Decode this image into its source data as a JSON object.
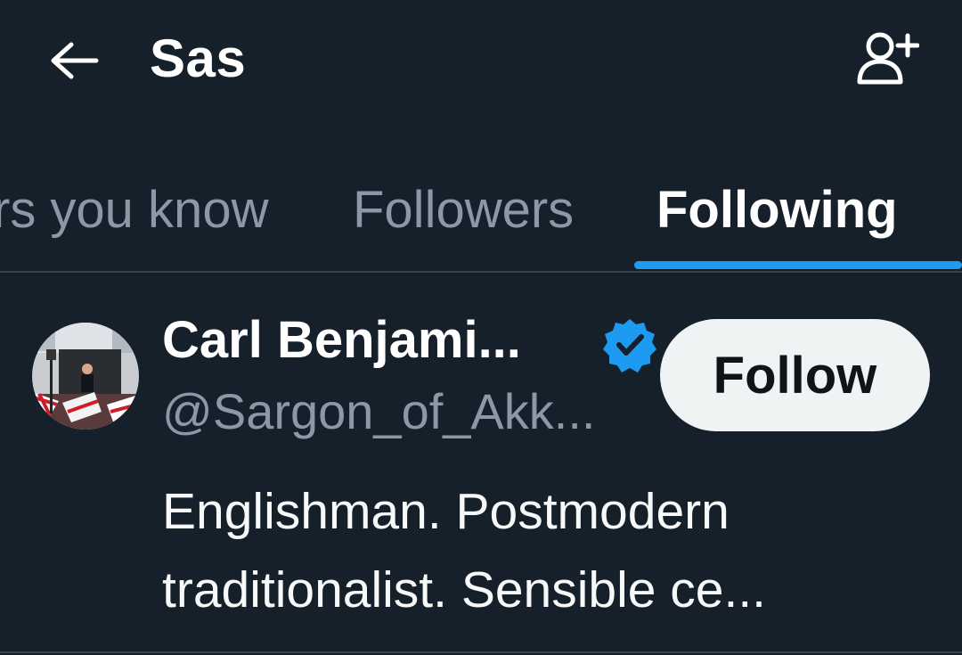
{
  "header": {
    "title": "Sas",
    "back_icon": "arrow-left-icon",
    "add_user_icon": "person-add-icon"
  },
  "tabs": [
    {
      "label": "Followers you know",
      "visible_label": "rs you know",
      "active": false
    },
    {
      "label": "Followers",
      "visible_label": "Followers",
      "active": false
    },
    {
      "label": "Following",
      "visible_label": "Following",
      "active": true
    }
  ],
  "users": [
    {
      "name": "Carl Benjami...",
      "verified": true,
      "handle": "@Sargon_of_Akk...",
      "follow_label": "Follow",
      "bio_lines": [
        "Englishman. Postmodern",
        "traditionalist. Sensible ce..."
      ]
    }
  ],
  "colors": {
    "background": "#15202b",
    "accent": "#1d9bf0",
    "secondary_text": "#8b98a5",
    "divider": "#38444d",
    "button_bg": "#eff3f4"
  }
}
